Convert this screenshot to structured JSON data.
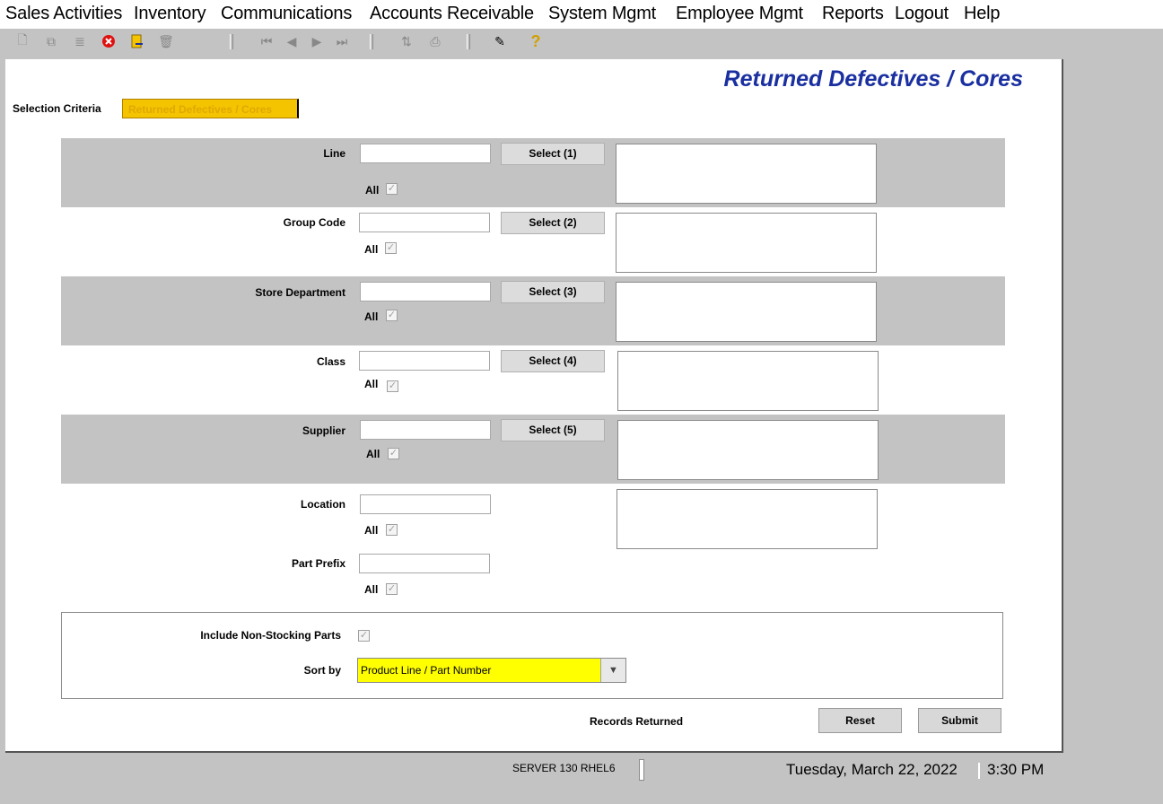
{
  "menu": [
    {
      "label": "Sales Activities",
      "u": "S"
    },
    {
      "label": "Inventory",
      "u": "I"
    },
    {
      "label": "Communications",
      "u": "C"
    },
    {
      "label": "Accounts Receivable",
      "u": "A"
    },
    {
      "label": "System Mgmt",
      "u": "e"
    },
    {
      "label": "Employee Mgmt",
      "u": "E"
    },
    {
      "label": "Reports",
      "u": "R"
    },
    {
      "label": "Logout",
      "u": "L"
    },
    {
      "label": "Help",
      "u": "H"
    }
  ],
  "toolbar": {
    "icons": [
      "new-doc-icon",
      "copy-icon",
      "record-icon",
      "cancel-icon",
      "export-icon",
      "delete-icon",
      "first-icon",
      "prev-icon",
      "next-icon",
      "last-icon",
      "sort-icon",
      "print-icon",
      "user-help-icon",
      "help-icon"
    ]
  },
  "title": "Returned Defectives / Cores",
  "tabs": {
    "selection": "Selection Criteria",
    "returned": "Returned Defectives / Cores"
  },
  "criteria": {
    "line": {
      "label": "Line",
      "button": "Select (1)",
      "all": "All"
    },
    "group_code": {
      "label": "Group Code",
      "button": "Select (2)",
      "all": "All"
    },
    "store_department": {
      "label": "Store Department",
      "button": "Select (3)",
      "all": "All"
    },
    "class": {
      "label": "Class",
      "button": "Select (4)",
      "all": "All"
    },
    "supplier": {
      "label": "Supplier",
      "button": "Select (5)",
      "all": "All"
    },
    "location": {
      "label": "Location",
      "all": "All"
    },
    "part_prefix": {
      "label": "Part Prefix",
      "all": "All"
    }
  },
  "options": {
    "include_non_stocking": "Include Non-Stocking Parts",
    "sort_by_label": "Sort by",
    "sort_by_value": "Product Line / Part Number"
  },
  "actions": {
    "records_returned": "Records Returned",
    "reset": "Reset",
    "submit": "Submit"
  },
  "status": {
    "server": "SERVER 130 RHEL6",
    "date": "Tuesday, March 22, 2022",
    "time": "3:30 PM"
  },
  "colors": {
    "title": "#1a2fa0",
    "tab_active": "#f5c400",
    "sort_bg": "#ffff00"
  }
}
